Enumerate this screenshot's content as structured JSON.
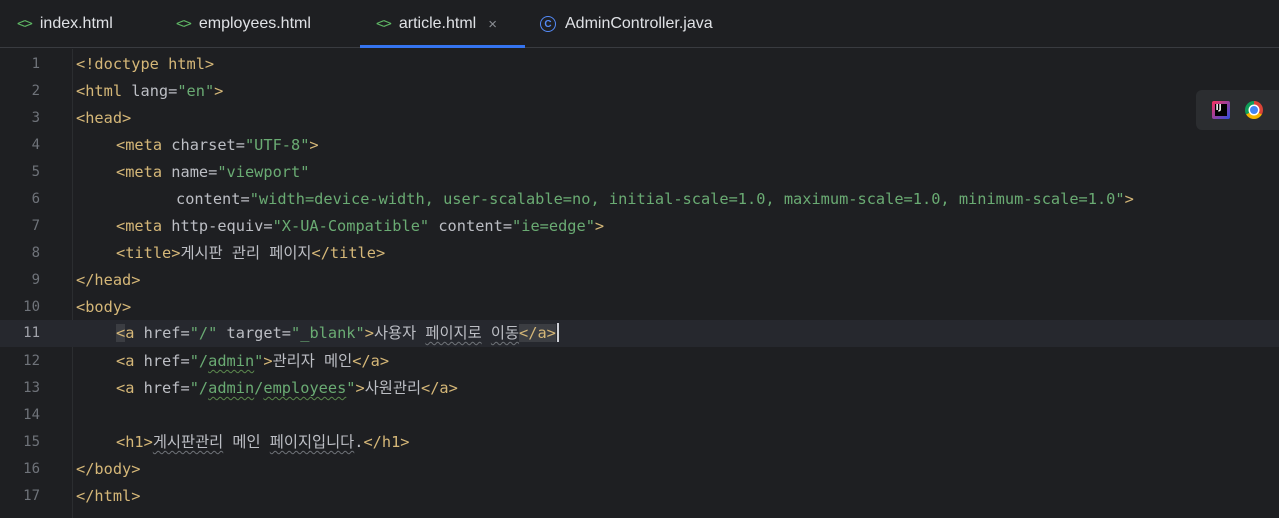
{
  "tabs": [
    {
      "label": "index.html",
      "icon": "html-file-icon"
    },
    {
      "label": "employees.html",
      "icon": "html-file-icon"
    },
    {
      "label": "article.html",
      "icon": "html-file-icon",
      "active": true,
      "close": "×"
    },
    {
      "label": "AdminController.java",
      "icon": "java-class-icon"
    }
  ],
  "tab_icons": {
    "html": "<>",
    "java": "C"
  },
  "accent_color": "#3574f0",
  "current_line": 11,
  "line_numbers": [
    "1",
    "2",
    "3",
    "4",
    "5",
    "6",
    "7",
    "8",
    "9",
    "10",
    "11",
    "12",
    "13",
    "14",
    "15",
    "16",
    "17"
  ],
  "code": {
    "l1": {
      "tag": "<!doctype html>"
    },
    "l2": {
      "open": "<html",
      "attr": " lang=",
      "val": "\"en\"",
      "close": ">"
    },
    "l3": {
      "tag": "<head>"
    },
    "l4": {
      "open": "<meta",
      "attr": " charset=",
      "val": "\"UTF-8\"",
      "close": ">"
    },
    "l5": {
      "open": "<meta",
      "attr": " name=",
      "val": "\"viewport\""
    },
    "l6": {
      "attr": "content=",
      "val": "\"width=device-width, user-scalable=no, initial-scale=1.0, maximum-scale=1.0, minimum-scale=1.0\"",
      "close": ">"
    },
    "l7": {
      "open": "<meta",
      "attr": " http-equiv=",
      "val": "\"X-UA-Compatible\"",
      "attr2": " content=",
      "val2": "\"ie=edge\"",
      "close": ">"
    },
    "l8": {
      "open": "<title>",
      "text": "게시판 관리 페이지",
      "close": "</title>"
    },
    "l9": {
      "tag": "</head>"
    },
    "l10": {
      "tag": "<body>"
    },
    "l11": {
      "lt": "<",
      "open": "a",
      "attr": " href=",
      "val": "\"/\"",
      "attr2": " target=",
      "val2": "\"_blank\"",
      "gt": ">",
      "text_a": "사용자 ",
      "text_b": "페이지로",
      "text_c": " ",
      "text_d": "이동",
      "close": "</a>"
    },
    "l12": {
      "open": "<a",
      "attr": " href=",
      "val_a": "\"/",
      "val_b": "admin",
      "val_c": "\"",
      "gt": ">",
      "text": "관리자 메인",
      "close": "</a>"
    },
    "l13": {
      "open": "<a",
      "attr": " href=",
      "val_a": "\"/",
      "val_b": "admin",
      "val_c": "/",
      "val_d": "employees",
      "val_e": "\"",
      "gt": ">",
      "text": "사원관리",
      "close": "</a>"
    },
    "l14": {},
    "l15": {
      "open": "<h1>",
      "text_a": "게시판관리",
      "text_b": " 메인 ",
      "text_c": "페이지입니다",
      "text_d": ".",
      "close": "</h1>"
    },
    "l16": {
      "tag": "</body>"
    },
    "l17": {
      "tag": "</html>"
    }
  },
  "browser_icons": [
    "intellij-icon",
    "chrome-icon"
  ]
}
